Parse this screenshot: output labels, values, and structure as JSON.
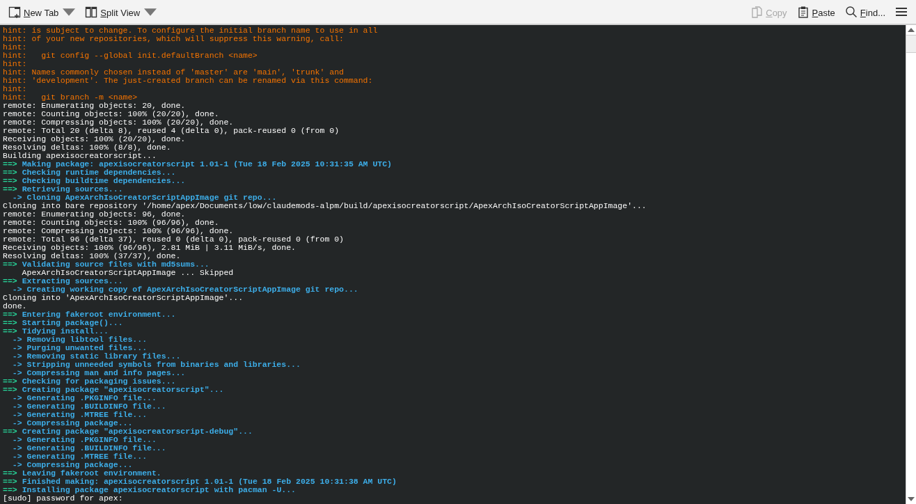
{
  "toolbar": {
    "left": [
      {
        "label": "New Tab",
        "kind": "newtab",
        "disabled": false,
        "dropdown": true
      },
      {
        "label": "Split View",
        "kind": "split",
        "disabled": false,
        "dropdown": true
      }
    ],
    "right": [
      {
        "label": "Copy",
        "kind": "copy",
        "disabled": true,
        "dropdown": false
      },
      {
        "label": "Paste",
        "kind": "paste",
        "disabled": false,
        "dropdown": false
      },
      {
        "label": "Find...",
        "kind": "find",
        "disabled": false,
        "dropdown": false
      }
    ]
  },
  "terminal": {
    "lines": [
      {
        "kind": "hint",
        "text": "hint: is subject to change. To configure the initial branch name to use in all"
      },
      {
        "kind": "hint",
        "text": "hint: of your new repositories, which will suppress this warning, call:"
      },
      {
        "kind": "hint",
        "text": "hint:"
      },
      {
        "kind": "hint",
        "text": "hint:   git config --global init.defaultBranch <name>"
      },
      {
        "kind": "hint",
        "text": "hint:"
      },
      {
        "kind": "hint",
        "text": "hint: Names commonly chosen instead of 'master' are 'main', 'trunk' and"
      },
      {
        "kind": "hint",
        "text": "hint: 'development'. The just-created branch can be renamed via this command:"
      },
      {
        "kind": "hint",
        "text": "hint:"
      },
      {
        "kind": "hint",
        "text": "hint:   git branch -m <name>"
      },
      {
        "kind": "plain",
        "text": "remote: Enumerating objects: 20, done."
      },
      {
        "kind": "plain",
        "text": "remote: Counting objects: 100% (20/20), done."
      },
      {
        "kind": "plain",
        "text": "remote: Compressing objects: 100% (20/20), done."
      },
      {
        "kind": "plain",
        "text": "remote: Total 20 (delta 8), reused 4 (delta 0), pack-reused 0 (from 0)"
      },
      {
        "kind": "plain",
        "text": "Receiving objects: 100% (20/20), done."
      },
      {
        "kind": "plain",
        "text": "Resolving deltas: 100% (8/8), done."
      },
      {
        "kind": "plain",
        "text": "Building apexisocreatorscript..."
      },
      {
        "kind": "step",
        "marker": "==>",
        "text": "Making package: apexisocreatorscript 1.01-1 (Tue 18 Feb 2025 10:31:35 AM UTC)"
      },
      {
        "kind": "step",
        "marker": "==>",
        "text": "Checking runtime dependencies..."
      },
      {
        "kind": "step",
        "marker": "==>",
        "text": "Checking buildtime dependencies..."
      },
      {
        "kind": "step",
        "marker": "==>",
        "text": "Retrieving sources..."
      },
      {
        "kind": "sub",
        "text": "  -> Cloning ApexArchIsoCreatorScriptAppImage git repo..."
      },
      {
        "kind": "plain",
        "text": "Cloning into bare repository '/home/apex/Documents/low/claudemods-alpm/build/apexisocreatorscript/ApexArchIsoCreatorScriptAppImage'..."
      },
      {
        "kind": "plain",
        "text": "remote: Enumerating objects: 96, done."
      },
      {
        "kind": "plain",
        "text": "remote: Counting objects: 100% (96/96), done."
      },
      {
        "kind": "plain",
        "text": "remote: Compressing objects: 100% (96/96), done."
      },
      {
        "kind": "plain",
        "text": "remote: Total 96 (delta 37), reused 0 (delta 0), pack-reused 0 (from 0)"
      },
      {
        "kind": "plain",
        "text": "Receiving objects: 100% (96/96), 2.81 MiB | 3.11 MiB/s, done."
      },
      {
        "kind": "plain",
        "text": "Resolving deltas: 100% (37/37), done."
      },
      {
        "kind": "step",
        "marker": "==>",
        "text": "Validating source files with md5sums..."
      },
      {
        "kind": "plain",
        "text": "    ApexArchIsoCreatorScriptAppImage ... Skipped"
      },
      {
        "kind": "step",
        "marker": "==>",
        "text": "Extracting sources..."
      },
      {
        "kind": "sub",
        "text": "  -> Creating working copy of ApexArchIsoCreatorScriptAppImage git repo..."
      },
      {
        "kind": "plain",
        "text": "Cloning into 'ApexArchIsoCreatorScriptAppImage'..."
      },
      {
        "kind": "plain",
        "text": "done."
      },
      {
        "kind": "step",
        "marker": "==>",
        "text": "Entering fakeroot environment..."
      },
      {
        "kind": "step",
        "marker": "==>",
        "text": "Starting package()..."
      },
      {
        "kind": "step",
        "marker": "==>",
        "text": "Tidying install..."
      },
      {
        "kind": "sub",
        "text": "  -> Removing libtool files..."
      },
      {
        "kind": "sub",
        "text": "  -> Purging unwanted files..."
      },
      {
        "kind": "sub",
        "text": "  -> Removing static library files..."
      },
      {
        "kind": "sub",
        "text": "  -> Stripping unneeded symbols from binaries and libraries..."
      },
      {
        "kind": "sub",
        "text": "  -> Compressing man and info pages..."
      },
      {
        "kind": "step",
        "marker": "==>",
        "text": "Checking for packaging issues..."
      },
      {
        "kind": "step",
        "marker": "==>",
        "text": "Creating package \"apexisocreatorscript\"..."
      },
      {
        "kind": "sub",
        "text": "  -> Generating .PKGINFO file..."
      },
      {
        "kind": "sub",
        "text": "  -> Generating .BUILDINFO file..."
      },
      {
        "kind": "sub",
        "text": "  -> Generating .MTREE file..."
      },
      {
        "kind": "sub",
        "text": "  -> Compressing package..."
      },
      {
        "kind": "step",
        "marker": "==>",
        "text": "Creating package \"apexisocreatorscript-debug\"..."
      },
      {
        "kind": "sub",
        "text": "  -> Generating .PKGINFO file..."
      },
      {
        "kind": "sub",
        "text": "  -> Generating .BUILDINFO file..."
      },
      {
        "kind": "sub",
        "text": "  -> Generating .MTREE file..."
      },
      {
        "kind": "sub",
        "text": "  -> Compressing package..."
      },
      {
        "kind": "step",
        "marker": "==>",
        "text": "Leaving fakeroot environment."
      },
      {
        "kind": "step",
        "marker": "==>",
        "text": "Finished making: apexisocreatorscript 1.01-1 (Tue 18 Feb 2025 10:31:38 AM UTC)"
      },
      {
        "kind": "step",
        "marker": "==>",
        "text": "Installing package apexisocreatorscript with pacman -U..."
      },
      {
        "kind": "plain",
        "text": "[sudo] password for apex:"
      }
    ]
  }
}
